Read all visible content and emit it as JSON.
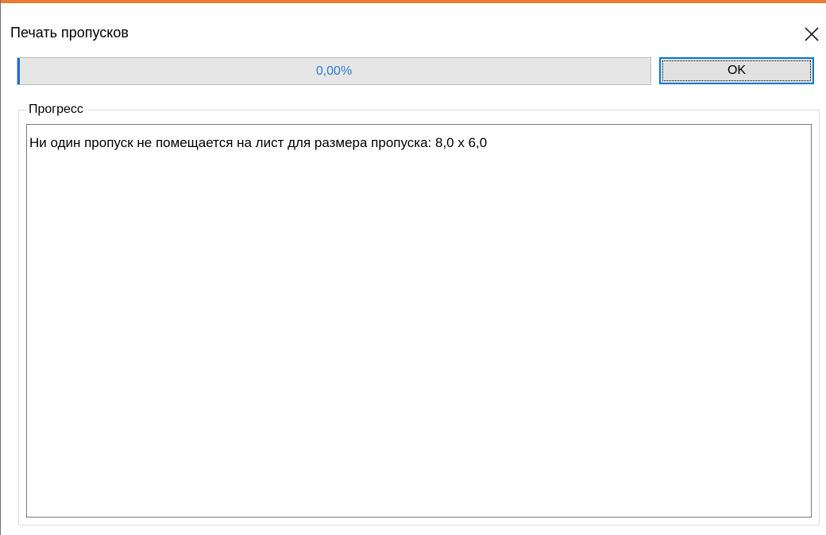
{
  "window": {
    "title": "Печать пропусков",
    "accent_color": "#ea7a2e",
    "close_icon": "close-icon"
  },
  "progress": {
    "value_text": "0,00%",
    "fraction": 0.0,
    "text_color": "#2a7fd4",
    "edge_color": "#1b73c9"
  },
  "buttons": {
    "ok_label": "OK"
  },
  "group": {
    "label": "Прогресс",
    "lines": [
      "Ни один пропуск не помещается на лист для размера пропуска: 8,0 х 6,0"
    ]
  }
}
